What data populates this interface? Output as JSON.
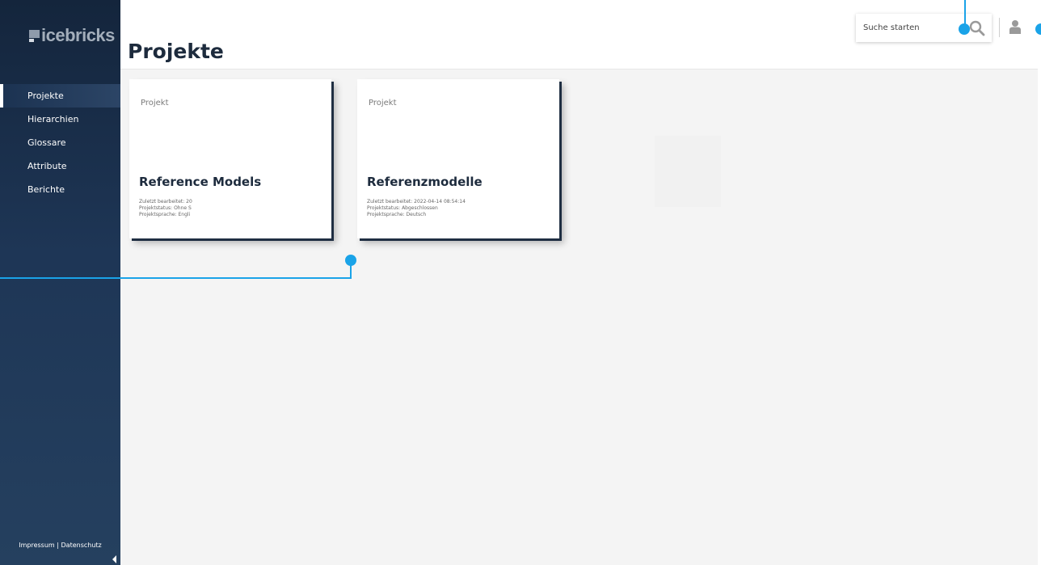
{
  "app": {
    "logo_text": "icebricks",
    "page_title": "Projekte"
  },
  "sidebar": {
    "items": [
      {
        "label": "Projekte",
        "active": true
      },
      {
        "label": "Hierarchien",
        "active": false
      },
      {
        "label": "Glossare",
        "active": false
      },
      {
        "label": "Attribute",
        "active": false
      },
      {
        "label": "Berichte",
        "active": false
      }
    ],
    "footer": {
      "impressum": "Impressum",
      "separator": "|",
      "datenschutz": "Datenschutz"
    }
  },
  "header": {
    "search_placeholder": "Suche starten",
    "icons": [
      "search-icon",
      "user-icon"
    ]
  },
  "cards": [
    {
      "type_label": "Projekt",
      "title": "Reference Models",
      "meta": [
        "Zuletzt bearbeitet: 20",
        "Projektstatus: Ohne S",
        "Projektsprache: Engli"
      ]
    },
    {
      "type_label": "Projekt",
      "title": "Referenzmodelle",
      "meta": [
        "Zuletzt bearbeitet: 2022-04-14 08:54:14",
        "Projektstatus: Abgeschlossen",
        "Projektsprache: Deutsch"
      ]
    }
  ],
  "colors": {
    "sidebar_bg": "#1e3656",
    "accent_callout": "#1aa3e8",
    "title_text": "#1d2b3d",
    "card_shadow": "#1f2e42"
  }
}
